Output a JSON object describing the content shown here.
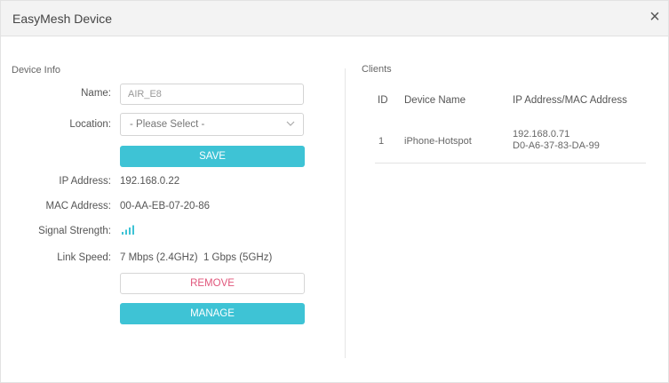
{
  "dialog": {
    "title": "EasyMesh Device",
    "close_glyph": "×"
  },
  "device_info": {
    "section_label": "Device Info",
    "name_label": "Name:",
    "name_value": "AIR_E8",
    "location_label": "Location:",
    "location_selected": "- Please Select -",
    "save_label": "SAVE",
    "ip_label": "IP Address:",
    "ip_value": "192.168.0.22",
    "mac_label": "MAC Address:",
    "mac_value": "00-AA-EB-07-20-86",
    "signal_label": "Signal Strength:",
    "signal_bars": 4,
    "link_label": "Link Speed:",
    "link_value": "7 Mbps (2.4GHz)  1 Gbps (5GHz)",
    "remove_label": "REMOVE",
    "manage_label": "MANAGE"
  },
  "clients": {
    "section_label": "Clients",
    "headers": [
      "ID",
      "Device Name",
      "IP Address/MAC Address"
    ],
    "rows": [
      {
        "id": "1",
        "name": "iPhone-Hotspot",
        "ip": "192.168.0.71",
        "mac": "D0-A6-37-83-DA-99"
      }
    ]
  },
  "colors": {
    "accent": "#3ec3d5",
    "remove_text": "#e0567b",
    "signal": "#3ec3d5"
  },
  "icons": {
    "close": "close-icon",
    "dropdown": "chevron-down-icon",
    "signal": "signal-strength-icon"
  }
}
